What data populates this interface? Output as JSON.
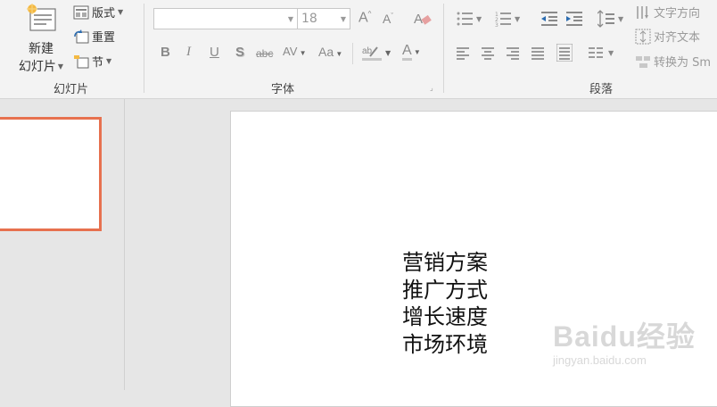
{
  "slides_group": {
    "new_slide_line1": "新建",
    "new_slide_line2": "幻灯片",
    "layout_label": "版式",
    "reset_label": "重置",
    "section_label": "节",
    "group_label": "幻灯片"
  },
  "font_group": {
    "font_name": "",
    "font_size": "18",
    "bold": "B",
    "italic": "I",
    "underline": "U",
    "shadow": "S",
    "strikethrough": "abc",
    "spacing": "AV",
    "change_case": "Aa",
    "font_color": "A",
    "grow": "A",
    "shrink": "A",
    "group_label": "字体"
  },
  "paragraph_group": {
    "text_direction": "文字方向",
    "align_text": "对齐文本",
    "convert_smartart": "转换为 Sm",
    "group_label": "段落"
  },
  "slide": {
    "lines": [
      "营销方案",
      "推广方式",
      "增长速度",
      "市场环境"
    ]
  },
  "watermark": {
    "logo": "Baidu经验",
    "url": "jingyan.baidu.com"
  },
  "colors": {
    "accent": "#e7714f",
    "ribbon_bg": "#f3f3f3",
    "workspace_bg": "#e6e6e6"
  }
}
